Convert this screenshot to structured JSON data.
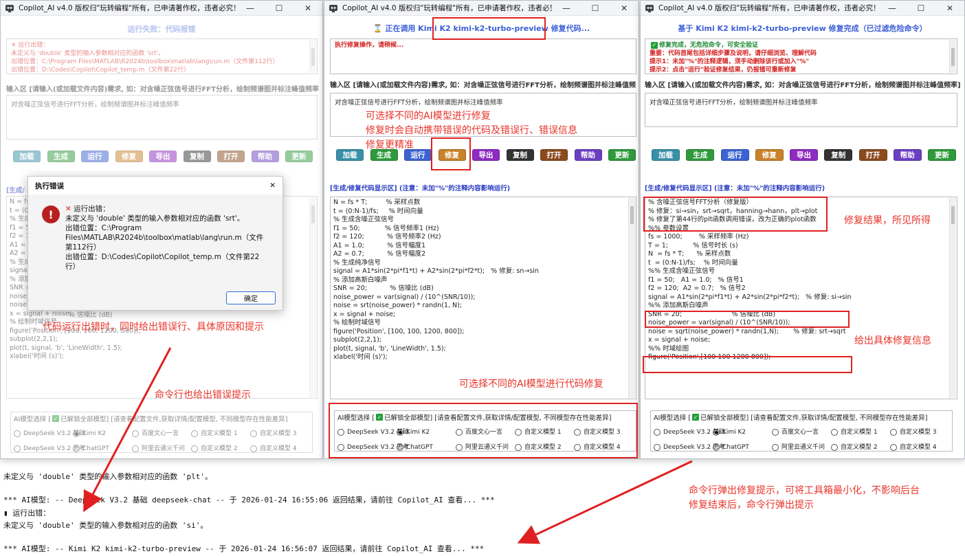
{
  "colors": {
    "load": "#3a90a8",
    "gen": "#2f9a3c",
    "run": "#3c63d2",
    "fix": "#c8822a",
    "export": "#8e2bc1",
    "copy": "#333333",
    "open": "#8b4b1f",
    "help": "#6b3fc2",
    "update": "#2f9a3c",
    "annotation": "#e02020"
  },
  "windows": {
    "left": {
      "title": "Copilot_AI v4.0 版权归\"玩转编程\"所有，已申请著作权，违者必究！",
      "status": "运行失败：代码报错",
      "msg": [
        "运行出错：",
        "未定义与 'double' 类型的输入参数相对应的函数 'srt'。",
        "出错位置：C:\\Program Files\\MATLAB\\R2024b\\toolbox\\matlab\\lang\\run.m（文件第112行）",
        "出错位置：D:\\Codes\\Copilot\\Copilot_temp.m（文件第22行）"
      ],
      "input_label": "输入区 [请输入(或加载文件内容)需求, 如：对含噪正弦信号进行FFT分析，绘制频谱图并标注峰值频率]",
      "input_text": "对含噪正弦信号进行FFT分析，绘制频谱图并标注峰值频率",
      "code_label": "[生成/",
      "code": [
        "N = fs",
        "t = (0:",
        "",
        "% 生成",
        "f1 = 5",
        "f2 = 1:",
        "A1 = 1",
        "A2 = (",
        "",
        "% 生成",
        "signal",
        "",
        "% 添加",
        "SNR = 20;",
        "noise_pow",
        "noise = srt(noise_power) * randn(1, N);",
        "x = signal + noise;",
        "",
        "% 绘制时域信号",
        "figure('Position', [100, 100, 1200, 800]);",
        "subplot(2,2,1);",
        "plot(t, signal, 'b', 'LineWidth', 1.5);",
        "xlabel('时间 (s)');"
      ],
      "code_snr_comment": "% 信噪比 (dB)"
    },
    "mid": {
      "title": "Copilot_AI v4.0 版权归\"玩转编程\"所有，已申请著作权，违者必究！",
      "status_prefix": "正在调用",
      "status_model": "Kimi K2 kimi-k2-turbo-preview",
      "status_suffix": "修复代码...",
      "msg": [
        "执行修复操作，请稍候..."
      ],
      "input_label": "输入区 [请输入(或加载文件内容)需求, 如：对含噪正弦信号进行FFT分析，绘制频谱图并标注峰值频率]",
      "input_text": "对含噪正弦信号进行FFT分析，绘制频谱图并标注峰值频率",
      "code_label": "[生成/修复代码显示区] (注意：未加\"%\"的注释内容影响运行)",
      "code": [
        "N = fs * T;         % 采样点数",
        "t = (0:N-1)/fs;     % 时间向量",
        "",
        "% 生成含噪正弦信号",
        "f1 = 50;            % 信号频率1 (Hz)",
        "f2 = 120;           % 信号频率2 (Hz)",
        "A1 = 1.0;           % 信号幅度1",
        "A2 = 0.7;           % 信号幅度2",
        "",
        "% 生成纯净信号",
        "signal = A1*sin(2*pi*f1*t) + A2*sin(2*pi*f2*t);   % 修复: sn→sin",
        "",
        "% 添加高斯白噪声",
        "SNR = 20;           % 信噪比 (dB)",
        "noise_power = var(signal) / (10^(SNR/10));",
        "noise = srt(noise_power) * randn(1, N);",
        "x = signal + noise;",
        "",
        "% 绘制时域信号",
        "figure('Position', [100, 100, 1200, 800]);",
        "subplot(2,2,1);",
        "plot(t, signal, 'b', 'LineWidth', 1.5);",
        "xlabel('时间 (s)');"
      ]
    },
    "right": {
      "title": "Copilot_AI v4.0 版权归\"玩转编程\"所有，已申请著作权，违者必究！",
      "status": "基于 Kimi K2 kimi-k2-turbo-preview 修复完成（已过滤危险命令）",
      "msg": [
        "修复完成，无危险命令，可安全验证",
        "重要：代码首尾包括详细步骤及说明，请仔细浏览、理解代码",
        "提示1：未加\"%\"的注释逻辑，须手动删除该行或加入\"%\"",
        "提示2：点击\"运行\"验证修复结果，仍报错可重新修复"
      ],
      "input_label": "输入区 [请输入(或加载文件内容)需求, 如：对含噪正弦信号进行FFT分析，绘制频谱图并标注峰值频率]",
      "input_text": "对含噪正弦信号进行FFT分析，绘制频谱图并标注峰值频率",
      "code_label": "[生成/修复代码显示区] (注意：未加\"%\"的注释内容影响运行)",
      "code": [
        "% 含噪正弦信号FFT分析（修复版）",
        "% 修复：si→sin，srt→sqrt，hanning→hann，plt→plot",
        "% 修复了第44行的plt函数调用错误，改为正确的plot函数",
        "",
        "%% 参数设置",
        "fs = 1000;        % 采样频率 (Hz)",
        "T = 1;            % 信号时长 (s)",
        "N  = fs * T;      % 采样点数",
        "t  = (0:N-1)/fs;    % 时间向量",
        "",
        "%% 生成含噪正弦信号",
        "f1 = 50;   A1 = 1.0;   % 信号1",
        "f2 = 120;  A2 = 0.7;   % 信号2",
        "signal = A1*sin(2*pi*f1*t) + A2*sin(2*pi*f2*t);   % 修复: si→sin",
        "",
        "%% 添加高斯白噪声",
        "SNR = 20;                        % 信噪比 (dB)",
        "noise_power = var(signal) / (10^(SNR/10));",
        "noise = sqrt(noise_power) * randn(1,N);       % 修复: srt→sqrt",
        "x = signal + noise;",
        "",
        "%% 时域绘图",
        "figure('Position',[100 100 1200 800]);"
      ]
    }
  },
  "buttons": {
    "load": "加载",
    "gen": "生成",
    "run": "运行",
    "fix": "修复",
    "export": "导出",
    "copy": "复制",
    "open": "打开",
    "help": "帮助",
    "update": "更新"
  },
  "model_header": {
    "prefix": "AI模型选择 [",
    "unlock": "已解锁全部模型]",
    "suffix": "[请查看配置文件,获取详情/配置模型, 不同模型存在性能差异]"
  },
  "models_row1": [
    "DeepSeek V3.2 基础",
    "Kimi K2",
    "百度文心一言",
    "自定义模型 1",
    "自定义模型 3"
  ],
  "models_row2": [
    "DeepSeek V3.2 思考",
    "ChatGPT",
    "阿里云通义千问",
    "自定义模型 2",
    "自定义模型 4"
  ],
  "dialog": {
    "title": "执行错误",
    "close": "✕",
    "lines": [
      "运行出错：",
      "未定义与 'double' 类型的输入参数相对应的函数 'srt'。",
      "出错位置：C:\\Program",
      "Files\\MATLAB\\R2024b\\toolbox\\matlab\\lang\\run.m（文件",
      "第112行）",
      "出错位置：D:\\Codes\\Copilot\\Copilot_temp.m（文件第22",
      "行）"
    ],
    "ok": "确定"
  },
  "annotations": {
    "a1": "可选择不同的AI模型进行修复",
    "a2": "修复时会自动携带错误的代码及错误行、错误信息",
    "a3": "修复更精准",
    "a4": "代码运行出错时，同时给出错误行、具体原因和提示",
    "a5": "命令行也给出错误提示",
    "a6": "可选择不同的AI模型进行代码修复",
    "a7": "修复结果，所见所得",
    "a8": "给出具体修复信息",
    "a9": "命令行弹出修复提示，可将工具箱最小化，不影响后台",
    "a10": "修复结束后，命令行弹出提示"
  },
  "terminal": {
    "l1": "未定义与 'double' 类型的输入参数相对应的函数 'plt'。",
    "l2": "*** AI模型: -- DeepSeek V3.2 基础 deepseek-chat -- 于 2026-01-24 16:55:06 返回结果，请前往 Copilot_AI 查看... ***",
    "l3": "运行出错：",
    "l4": "未定义与 'double' 类型的输入参数相对应的函数 'si'。",
    "l5": "*** AI模型: -- Kimi K2 kimi-k2-turbo-preview -- 于 2026-01-24 16:56:07 返回结果，请前往 Copilot_AI 查看... ***"
  }
}
